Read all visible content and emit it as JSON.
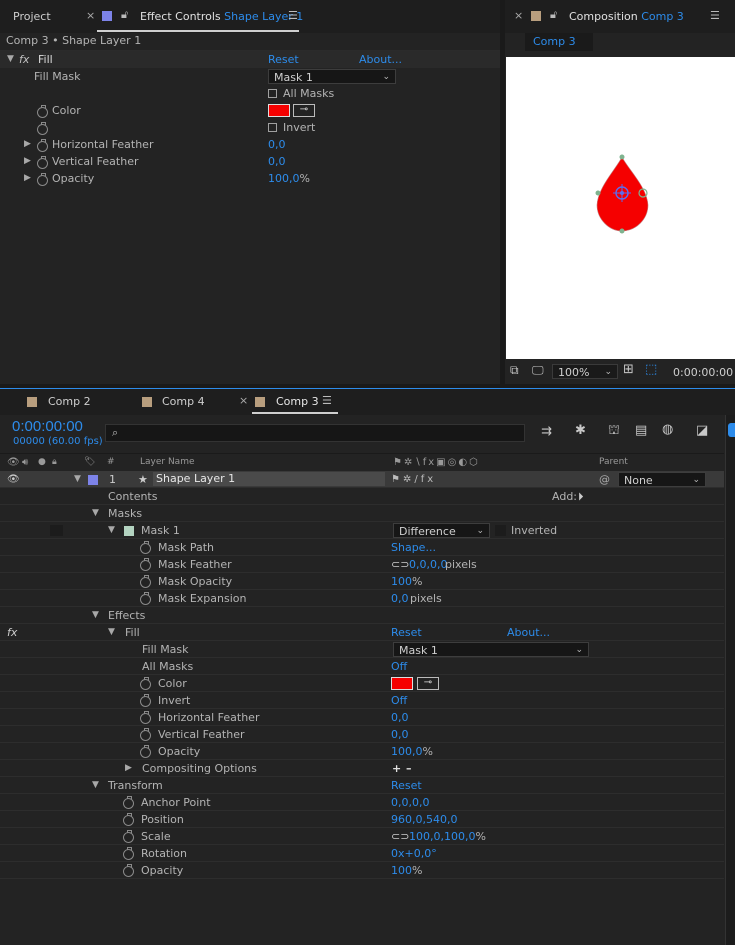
{
  "left_panel": {
    "tab_project": "Project",
    "tab_effect_controls": "Effect Controls",
    "tab_effect_layer": "Shape Layer 1",
    "breadcrumb": "Comp 3 • Shape Layer 1",
    "effect_name": "Fill",
    "reset": "Reset",
    "about": "About...",
    "fill_mask_label": "Fill Mask",
    "fill_mask_value": "Mask 1",
    "all_masks_label": "All Masks",
    "color_label": "Color",
    "invert_label": "Invert",
    "h_feather_label": "Horizontal Feather",
    "h_feather_value": "0,0",
    "v_feather_label": "Vertical Feather",
    "v_feather_value": "0,0",
    "opacity_label": "Opacity",
    "opacity_value": "100,0",
    "opacity_unit": "%"
  },
  "comp_panel": {
    "tab_label": "Composition",
    "comp_name": "Comp 3",
    "comp_button": "Comp 3",
    "zoom": "100%",
    "time": "0:00:00:00"
  },
  "timeline": {
    "tabs": [
      "Comp 2",
      "Comp 4",
      "Comp 3"
    ],
    "timecode": "0:00:00:00",
    "frame_info": "00000 (60.00 fps)",
    "search_placeholder": "",
    "col_layer_name": "Layer Name",
    "col_parent": "Parent",
    "layer_index": "1",
    "layer_name": "Shape Layer 1",
    "parent_value": "None",
    "contents": "Contents",
    "add_label": "Add:",
    "masks": "Masks",
    "mask1": "Mask 1",
    "mask_mode": "Difference",
    "inverted": "Inverted",
    "mask_path": "Mask Path",
    "mask_path_value": "Shape...",
    "mask_feather": "Mask Feather",
    "mask_feather_value": "0,0,0,0",
    "pixels": "pixels",
    "mask_opacity": "Mask Opacity",
    "mask_opacity_value": "100",
    "pct": "%",
    "mask_expansion": "Mask Expansion",
    "mask_expansion_value": "0,0",
    "effects": "Effects",
    "fill": "Fill",
    "reset": "Reset",
    "about": "About...",
    "fill_mask": "Fill Mask",
    "fill_mask_value": "Mask 1",
    "all_masks": "All Masks",
    "all_masks_value": "Off",
    "color": "Color",
    "invert": "Invert",
    "invert_value": "Off",
    "h_feather": "Horizontal Feather",
    "h_feather_value": "0,0",
    "v_feather": "Vertical Feather",
    "v_feather_value": "0,0",
    "opacity": "Opacity",
    "opacity_value": "100,0",
    "compositing": "Compositing Options",
    "transform": "Transform",
    "transform_reset": "Reset",
    "anchor": "Anchor Point",
    "anchor_value": "0,0,0,0",
    "position": "Position",
    "position_value": "960,0,540,0",
    "scale": "Scale",
    "scale_value": "100,0,100,0",
    "rotation": "Rotation",
    "rotation_value": "0x+0,0°",
    "t_opacity": "Opacity",
    "t_opacity_value": "100"
  },
  "colors": {
    "accent": "#2d8ceb",
    "fill_red": "#f50000",
    "bg": "#232323"
  }
}
